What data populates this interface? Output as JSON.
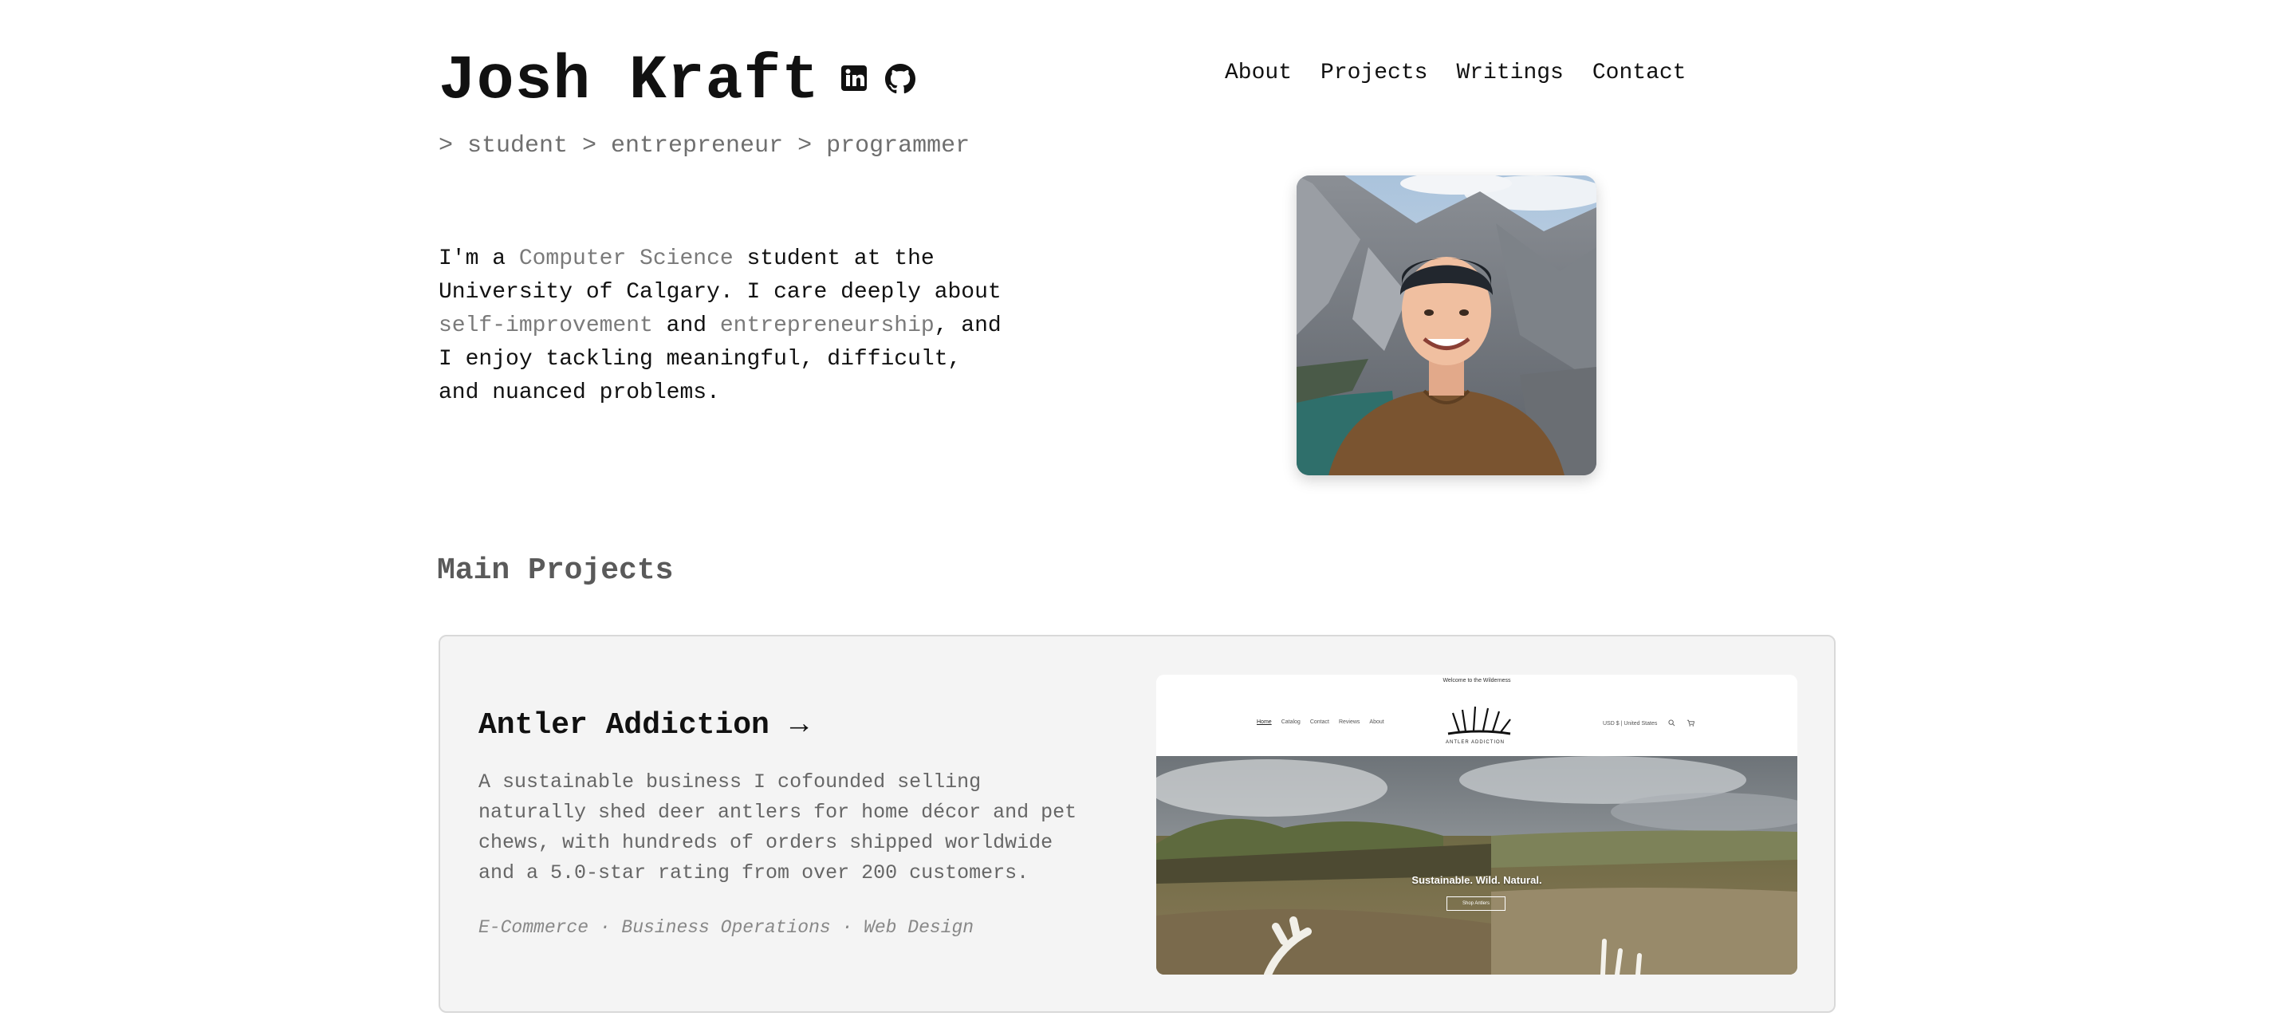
{
  "header": {
    "name": "Josh Kraft",
    "tagline": "> student > entrepreneur > programmer",
    "social": [
      {
        "name": "linkedin-icon"
      },
      {
        "name": "github-icon"
      }
    ]
  },
  "nav": {
    "items": [
      "About",
      "Projects",
      "Writings",
      "Contact"
    ]
  },
  "bio": {
    "p1": "I'm a ",
    "h1": "Computer Science",
    "p2": " student at the University of Calgary. I care deeply about ",
    "h2": "self-improvement",
    "p3": " and ",
    "h3": "entrepreneurship",
    "p4": ", and I enjoy tackling meaningful, difficult, and nuanced problems."
  },
  "portrait": {
    "subject": "photo-of-person-in-mountains"
  },
  "projects": {
    "section_title": "Main Projects",
    "items": [
      {
        "title": "Antler Addiction",
        "arrow": "→",
        "description": "A sustainable business I cofounded selling naturally shed deer antlers for home décor and pet chews, with hundreds of orders shipped worldwide and a 5.0-star rating from over 200 customers.",
        "tags": "E-Commerce · Business Operations · Web Design",
        "screenshot": {
          "topline": "Welcome to the Wilderness",
          "nav": [
            "Home",
            "Catalog",
            "Contact",
            "Reviews",
            "About"
          ],
          "logo_text": "ANTLER ADDICTION",
          "region": "USD $ | United States",
          "hero_text": "Sustainable. Wild. Natural.",
          "hero_button": "Shop Antlers"
        }
      }
    ]
  },
  "colors": {
    "accent_text": "#7a7a7a",
    "card_bg": "#f4f4f4",
    "card_border": "#d9d9d9"
  }
}
